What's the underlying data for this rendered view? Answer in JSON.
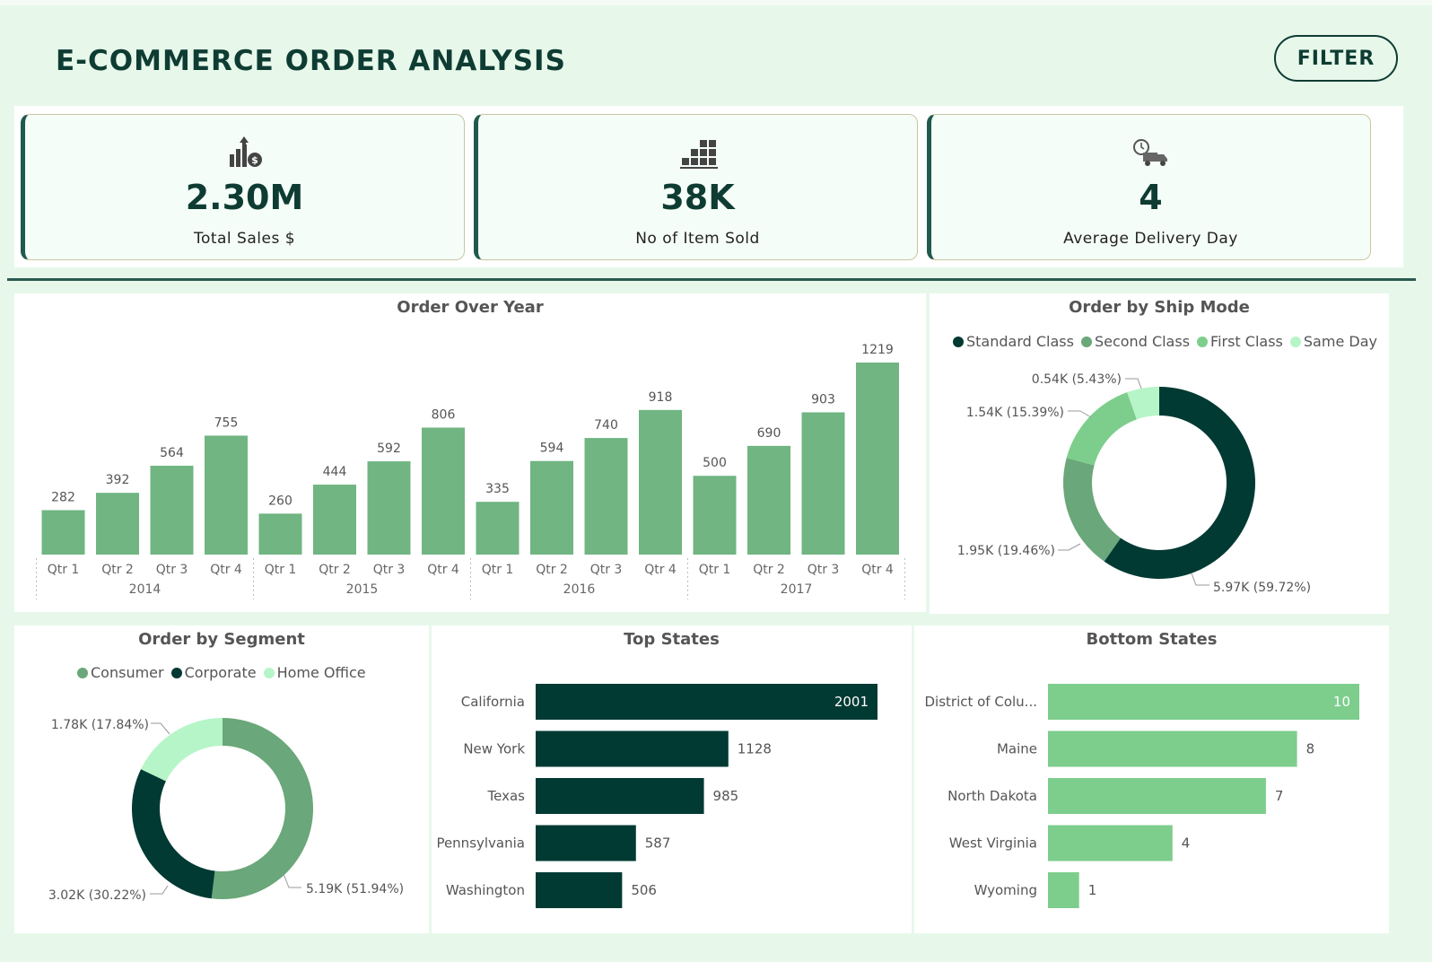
{
  "header": {
    "title": "E-COMMERCE ORDER ANALYSIS",
    "filter_label": "FILTER"
  },
  "kpis": [
    {
      "icon": "sales-growth-icon",
      "value": "2.30M",
      "label": "Total Sales $"
    },
    {
      "icon": "boxes-icon",
      "value": "38K",
      "label": "No of Item Sold"
    },
    {
      "icon": "delivery-truck-icon",
      "value": "4",
      "label": "Average Delivery Day"
    }
  ],
  "colors": {
    "dark": "#003a33",
    "mid": "#6aa77a",
    "bar": "#70b582",
    "light": "#7dce8c",
    "pale": "#b6f5c8"
  },
  "chart_data": [
    {
      "type": "bar",
      "title": "Order Over Year",
      "categories": [
        "Qtr 1",
        "Qtr 2",
        "Qtr 3",
        "Qtr 4",
        "Qtr 1",
        "Qtr 2",
        "Qtr 3",
        "Qtr 4",
        "Qtr 1",
        "Qtr 2",
        "Qtr 3",
        "Qtr 4",
        "Qtr 1",
        "Qtr 2",
        "Qtr 3",
        "Qtr 4"
      ],
      "groups": [
        "2014",
        "2015",
        "2016",
        "2017"
      ],
      "values": [
        282,
        392,
        564,
        755,
        260,
        444,
        592,
        806,
        335,
        594,
        740,
        918,
        500,
        690,
        903,
        1219
      ]
    },
    {
      "type": "pie",
      "title": "Order by Ship Mode",
      "labels": [
        "Standard Class",
        "Second Class",
        "First Class",
        "Same Day"
      ],
      "values": [
        59.72,
        19.46,
        15.39,
        5.43
      ],
      "data_labels": [
        "5.97K (59.72%)",
        "1.95K (19.46%)",
        "1.54K (15.39%)",
        "0.54K (5.43%)"
      ],
      "colors": [
        "#003a33",
        "#6aa77a",
        "#7dce8c",
        "#b6f5c8"
      ]
    },
    {
      "type": "pie",
      "title": "Order by Segment",
      "labels": [
        "Consumer",
        "Corporate",
        "Home Office"
      ],
      "values": [
        51.94,
        30.22,
        17.84
      ],
      "data_labels": [
        "5.19K (51.94%)",
        "3.02K (30.22%)",
        "1.78K (17.84%)"
      ],
      "colors": [
        "#6aa77a",
        "#003a33",
        "#b6f5c8"
      ]
    },
    {
      "type": "bar",
      "orientation": "horizontal",
      "title": "Top States",
      "categories": [
        "California",
        "New York",
        "Texas",
        "Pennsylvania",
        "Washington"
      ],
      "values": [
        2001,
        1128,
        985,
        587,
        506
      ]
    },
    {
      "type": "bar",
      "orientation": "horizontal",
      "title": "Bottom States",
      "categories": [
        "District of Colu...",
        "Maine",
        "North Dakota",
        "West Virginia",
        "Wyoming"
      ],
      "values": [
        10,
        8,
        7,
        4,
        1
      ]
    }
  ]
}
